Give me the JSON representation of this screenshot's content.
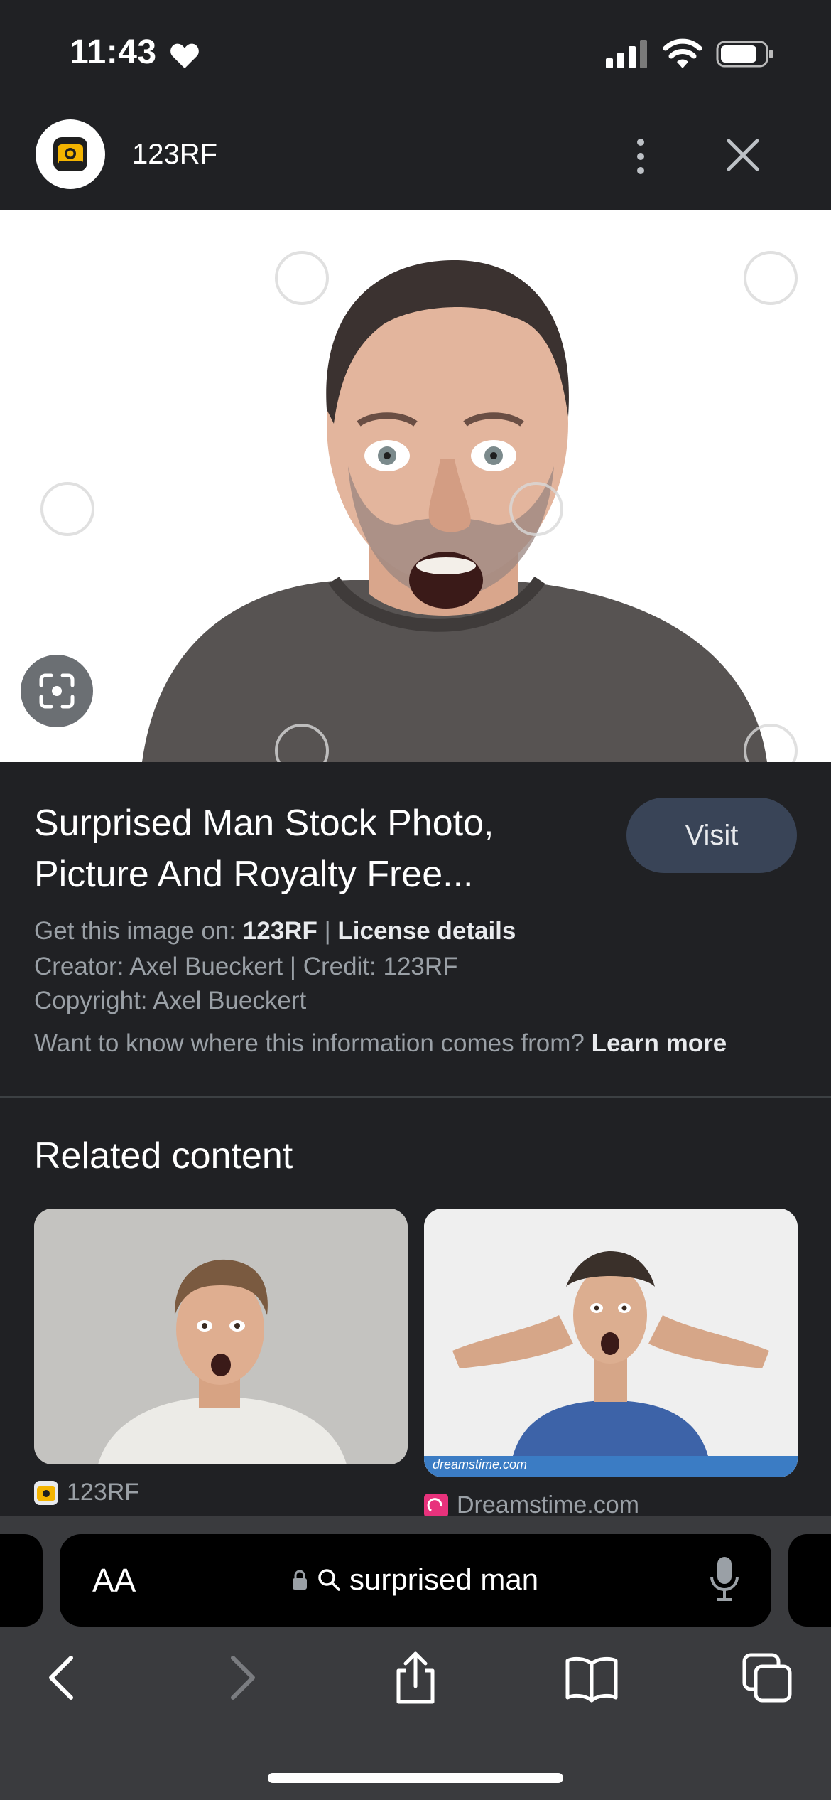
{
  "status_bar": {
    "time": "11:43"
  },
  "header": {
    "source": "123RF"
  },
  "result": {
    "title": "Surprised Man Stock Photo, Picture And Royalty Free...",
    "visit_label": "Visit",
    "get_image_prefix": "Get this image on:",
    "get_image_source": "123RF",
    "separator": "|",
    "license_label": "License details",
    "creator_line": "Creator: Axel Bueckert | Credit: 123RF",
    "copyright_line": "Copyright: Axel Bueckert",
    "info_prompt": "Want to know where this information comes from?",
    "learn_more": "Learn more"
  },
  "related": {
    "heading": "Related content",
    "items": [
      {
        "source": "123RF"
      },
      {
        "source": "Dreamstime.com",
        "caption": "dreamstime.com"
      }
    ]
  },
  "browser": {
    "aa_label": "AA",
    "query": "surprised man"
  },
  "colors": {
    "background": "#202124",
    "visit_button": "#394457",
    "toolbar": "#3a3b3e"
  }
}
